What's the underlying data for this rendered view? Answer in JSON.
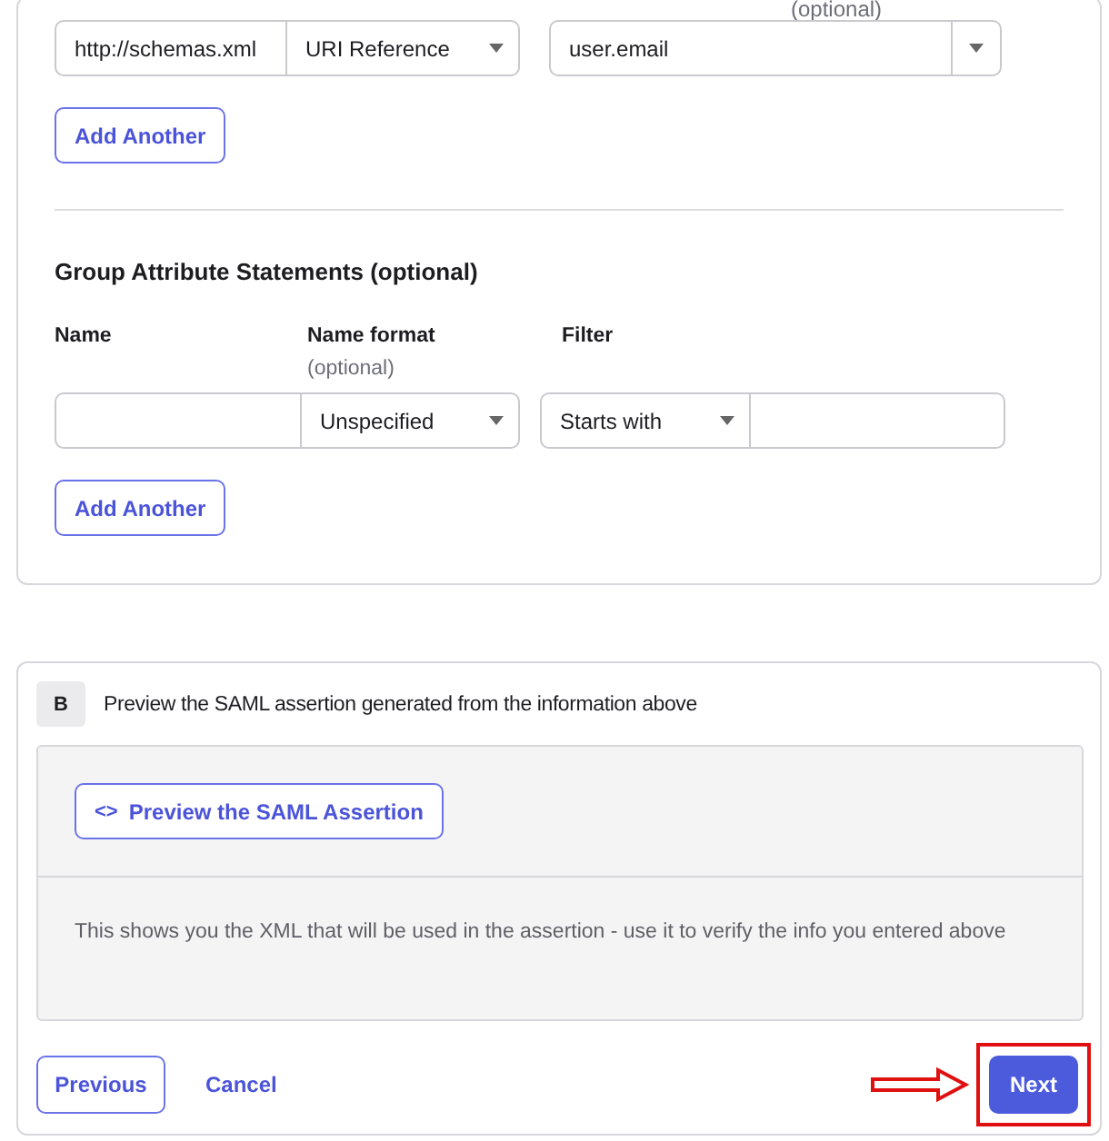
{
  "attribute_statements": {
    "cut_label": "(optional)",
    "row": {
      "name_value": "http://schemas.xml",
      "name_format": "URI Reference",
      "value": "user.email"
    },
    "add_button": "Add Another"
  },
  "group_attribute_statements": {
    "title": "Group Attribute Statements (optional)",
    "columns": [
      {
        "label": "Name"
      },
      {
        "label": "Name format",
        "hint": "(optional)"
      },
      {
        "label": "Filter"
      }
    ],
    "row": {
      "name_format": "Unspecified",
      "filter": "Starts with"
    },
    "add_button": "Add Another"
  },
  "section_b": {
    "badge": "B",
    "title": "Preview the SAML assertion generated from the information above",
    "preview_button": {
      "icon": "<>",
      "label": "Preview the SAML Assertion"
    },
    "description": "This shows you the XML that will be used in the assertion - use it to verify the info you entered above"
  },
  "footer": {
    "previous": "Previous",
    "cancel": "Cancel",
    "next": "Next"
  }
}
